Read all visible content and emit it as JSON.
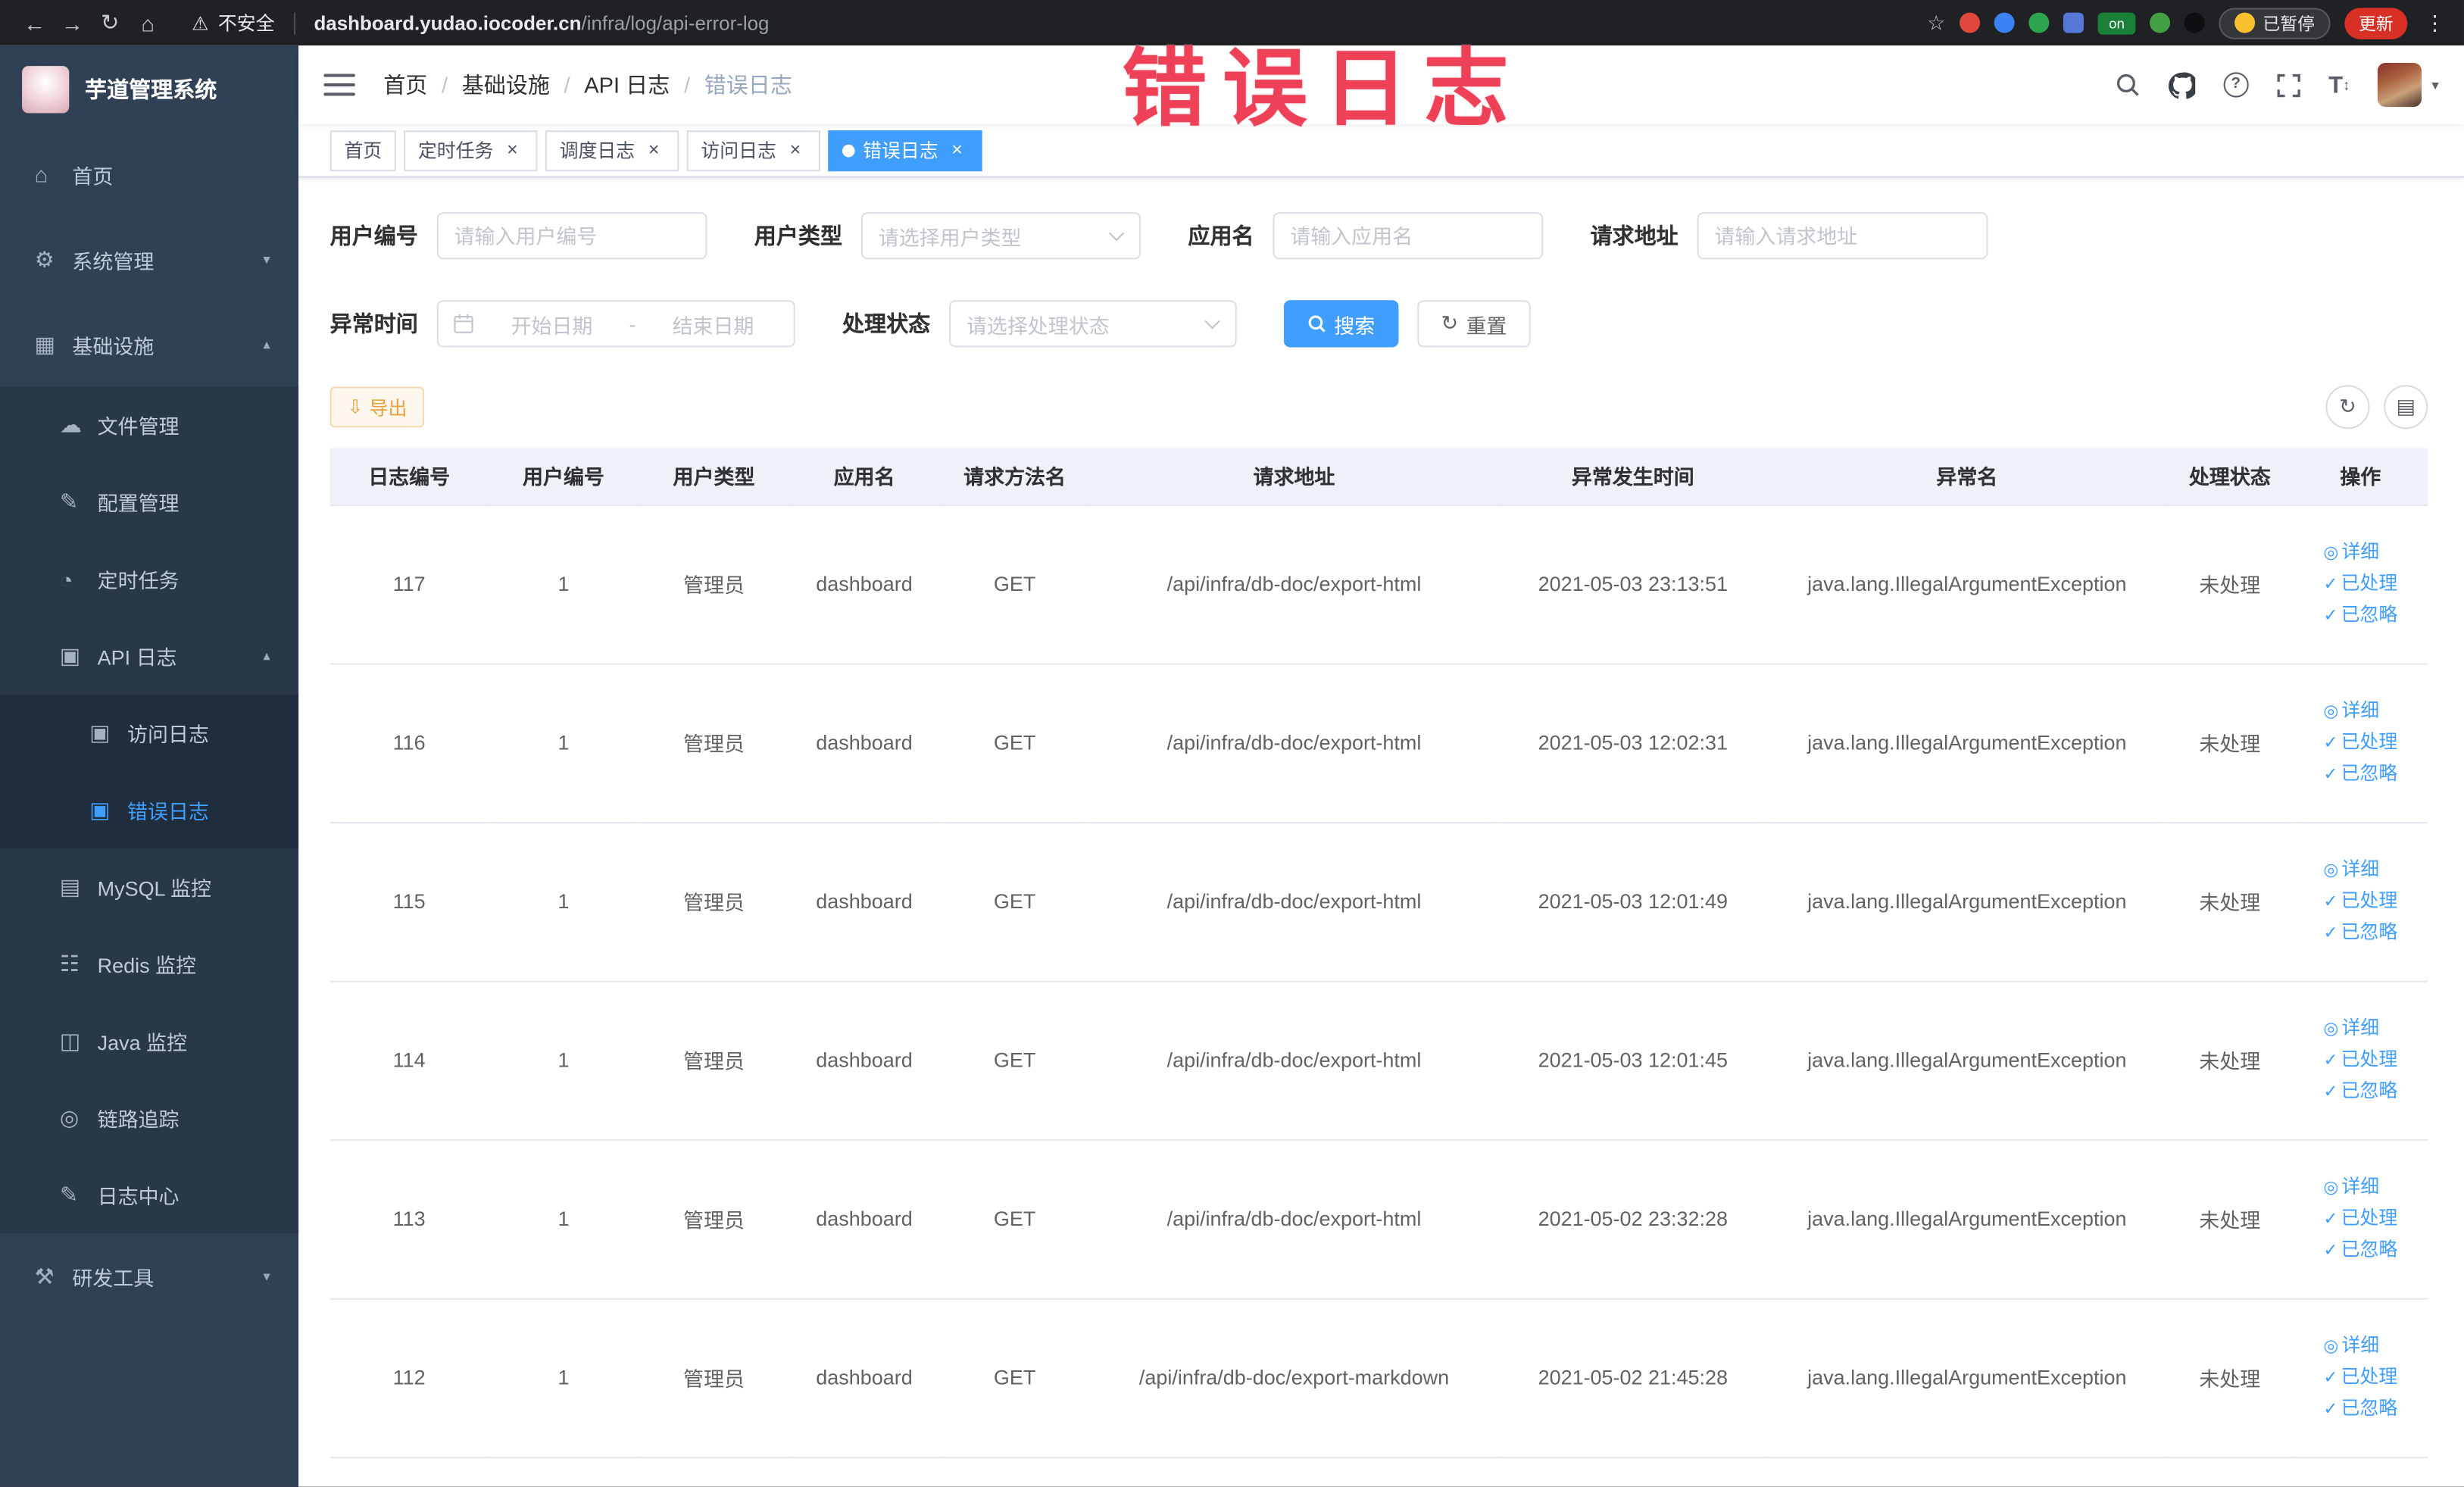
{
  "browser": {
    "security_label": "不安全",
    "url_domain": "dashboard.yudao.iocoder.cn",
    "url_path": "/infra/log/api-error-log",
    "on_badge": "on",
    "paused_badge": "已暂停",
    "update_button": "更新"
  },
  "icons": {
    "back": "←",
    "forward": "→",
    "reload": "↻",
    "home": "⌂",
    "warning": "⚠",
    "star": "☆",
    "kebab": "⋮",
    "caret_down": "▾",
    "close": "×",
    "question": "?",
    "font_size": "T",
    "updown": "↕",
    "refresh": "↻",
    "columns": "▤",
    "download": "⇩",
    "eye": "◎",
    "check": "✓"
  },
  "annotation": {
    "text": "错误日志"
  },
  "sidebar": {
    "logo_title": "芋道管理系统",
    "items": [
      {
        "label": "首页",
        "icon": "⌂"
      },
      {
        "label": "系统管理",
        "icon": "⚙",
        "arrow": "▾"
      },
      {
        "label": "基础设施",
        "icon": "▦",
        "arrow": "▴"
      },
      {
        "label": "文件管理",
        "icon": "☁"
      },
      {
        "label": "配置管理",
        "icon": "✎"
      },
      {
        "label": "定时任务",
        "icon": "◔"
      },
      {
        "label": "API 日志",
        "icon": "▣",
        "arrow": "▴"
      },
      {
        "label": "访问日志",
        "icon": "▣"
      },
      {
        "label": "错误日志",
        "icon": "▣"
      },
      {
        "label": "MySQL 监控",
        "icon": "▤"
      },
      {
        "label": "Redis 监控",
        "icon": "☷"
      },
      {
        "label": "Java 监控",
        "icon": "◫"
      },
      {
        "label": "链路追踪",
        "icon": "◎"
      },
      {
        "label": "日志中心",
        "icon": "✎"
      },
      {
        "label": "研发工具",
        "icon": "⚒",
        "arrow": "▾"
      }
    ]
  },
  "breadcrumb": {
    "separator": "/",
    "items": [
      "首页",
      "基础设施",
      "API 日志",
      "错误日志"
    ]
  },
  "tabs": [
    {
      "label": "首页"
    },
    {
      "label": "定时任务"
    },
    {
      "label": "调度日志"
    },
    {
      "label": "访问日志"
    },
    {
      "label": "错误日志"
    }
  ],
  "filters": {
    "user_id_label": "用户编号",
    "user_id_placeholder": "请输入用户编号",
    "user_type_label": "用户类型",
    "user_type_placeholder": "请选择用户类型",
    "app_name_label": "应用名",
    "app_name_placeholder": "请输入应用名",
    "request_url_label": "请求地址",
    "request_url_placeholder": "请输入请求地址",
    "exception_time_label": "异常时间",
    "start_placeholder": "开始日期",
    "range_separator": "-",
    "end_placeholder": "结束日期",
    "status_label": "处理状态",
    "status_placeholder": "请选择处理状态",
    "search_button": "搜索",
    "reset_button": "重置"
  },
  "toolbar": {
    "export_button": "导出"
  },
  "table": {
    "columns": [
      "日志编号",
      "用户编号",
      "用户类型",
      "应用名",
      "请求方法名",
      "请求地址",
      "异常发生时间",
      "异常名",
      "处理状态",
      "操作"
    ],
    "actions": [
      "详细",
      "已处理",
      "已忽略"
    ],
    "rows": [
      {
        "id": "117",
        "user_id": "1",
        "user_type": "管理员",
        "app": "dashboard",
        "method": "GET",
        "url": "/api/infra/db-doc/export-html",
        "time": "2021-05-03 23:13:51",
        "exception": "java.lang.IllegalArgumentException",
        "status": "未处理"
      },
      {
        "id": "116",
        "user_id": "1",
        "user_type": "管理员",
        "app": "dashboard",
        "method": "GET",
        "url": "/api/infra/db-doc/export-html",
        "time": "2021-05-03 12:02:31",
        "exception": "java.lang.IllegalArgumentException",
        "status": "未处理"
      },
      {
        "id": "115",
        "user_id": "1",
        "user_type": "管理员",
        "app": "dashboard",
        "method": "GET",
        "url": "/api/infra/db-doc/export-html",
        "time": "2021-05-03 12:01:49",
        "exception": "java.lang.IllegalArgumentException",
        "status": "未处理"
      },
      {
        "id": "114",
        "user_id": "1",
        "user_type": "管理员",
        "app": "dashboard",
        "method": "GET",
        "url": "/api/infra/db-doc/export-html",
        "time": "2021-05-03 12:01:45",
        "exception": "java.lang.IllegalArgumentException",
        "status": "未处理"
      },
      {
        "id": "113",
        "user_id": "1",
        "user_type": "管理员",
        "app": "dashboard",
        "method": "GET",
        "url": "/api/infra/db-doc/export-html",
        "time": "2021-05-02 23:32:28",
        "exception": "java.lang.IllegalArgumentException",
        "status": "未处理"
      },
      {
        "id": "112",
        "user_id": "1",
        "user_type": "管理员",
        "app": "dashboard",
        "method": "GET",
        "url": "/api/infra/db-doc/export-markdown",
        "time": "2021-05-02 21:45:28",
        "exception": "java.lang.IllegalArgumentException",
        "status": "未处理"
      }
    ]
  }
}
